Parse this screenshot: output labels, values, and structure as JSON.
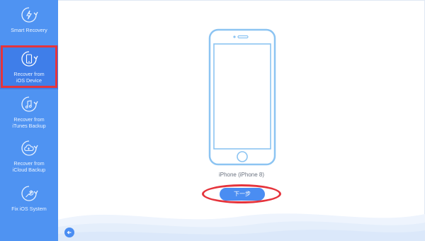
{
  "sidebar": {
    "items": [
      {
        "label": "Smart Recovery",
        "icon": "lightning-refresh-icon"
      },
      {
        "label": "Recover from\niOS Device",
        "icon": "phone-refresh-icon",
        "active": true
      },
      {
        "label": "Recover from\niTunes Backup",
        "icon": "music-note-refresh-icon"
      },
      {
        "label": "Recover from\niCloud Backup",
        "icon": "cloud-refresh-icon"
      },
      {
        "label": "Fix iOS System",
        "icon": "wrench-icon"
      }
    ]
  },
  "main": {
    "device_name": "iPhone (iPhone 8)",
    "next_button": "下一步"
  },
  "colors": {
    "sidebar": "#4f93f2",
    "accent": "#4a8df2",
    "highlight": "#e5343c",
    "phone_outline": "#8cc4f2"
  }
}
